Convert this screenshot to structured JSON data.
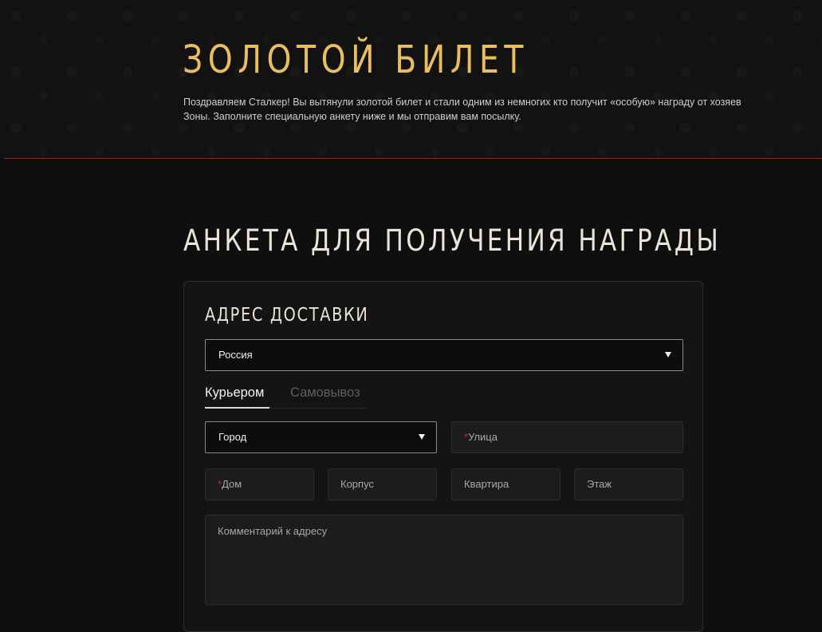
{
  "hero": {
    "title": "ЗОЛОТОЙ БИЛЕТ",
    "description": "Поздравляем Сталкер! Вы вытянули золотой билет и стали одним из немногих кто получит «особую» награду от хозяев Зоны. Заполните специальную анкету ниже и мы отправим вам посылку."
  },
  "form": {
    "title": "АНКЕТА ДЛЯ ПОЛУЧЕНИЯ НАГРАДЫ",
    "section_title": "АДРЕС ДОСТАВКИ",
    "country_select": {
      "value": "Россия"
    },
    "tabs": [
      {
        "label": "Курьером",
        "active": true
      },
      {
        "label": "Самовывоз",
        "active": false
      }
    ],
    "city_select": {
      "value": "Город"
    },
    "fields": {
      "street": {
        "placeholder": "Улица",
        "required": true
      },
      "house": {
        "placeholder": "Дом",
        "required": true
      },
      "building": {
        "placeholder": "Корпус",
        "required": false
      },
      "apartment": {
        "placeholder": "Квартира",
        "required": false
      },
      "floor": {
        "placeholder": "Этаж",
        "required": false
      },
      "comment": {
        "placeholder": "Комментарий к адресу",
        "required": false
      }
    },
    "required_marker": "*"
  },
  "colors": {
    "accent_gold": "#e8be5f",
    "divider_red": "#b3141b",
    "required_red": "#d0242b",
    "background": "#0f0f0f"
  },
  "icons": {
    "select_caret": "caret-down-icon"
  }
}
